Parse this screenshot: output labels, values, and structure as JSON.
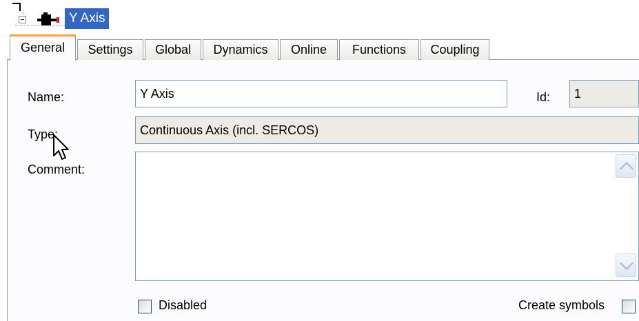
{
  "tree": {
    "node_label": "Y Axis",
    "expander_icon": "minus-expander-icon",
    "node_icon": "axis-drive-icon"
  },
  "tabs": [
    {
      "label": "General",
      "active": true
    },
    {
      "label": "Settings",
      "active": false
    },
    {
      "label": "Global",
      "active": false
    },
    {
      "label": "Dynamics",
      "active": false
    },
    {
      "label": "Online",
      "active": false
    },
    {
      "label": "Functions",
      "active": false
    },
    {
      "label": "Coupling",
      "active": false
    }
  ],
  "form": {
    "name_label": "Name:",
    "name_value": "Y Axis",
    "id_label": "Id:",
    "id_value": "1",
    "type_label": "Type:",
    "type_value": "Continuous Axis (incl. SERCOS)",
    "comment_label": "Comment:",
    "comment_value": "",
    "disabled_label": "Disabled",
    "disabled_checked": false,
    "create_symbols_label": "Create symbols",
    "create_symbols_checked": false
  },
  "colors": {
    "selection": "#3166c7",
    "active_tab_accent": "#f7a63a",
    "border": "#7f9db9"
  }
}
